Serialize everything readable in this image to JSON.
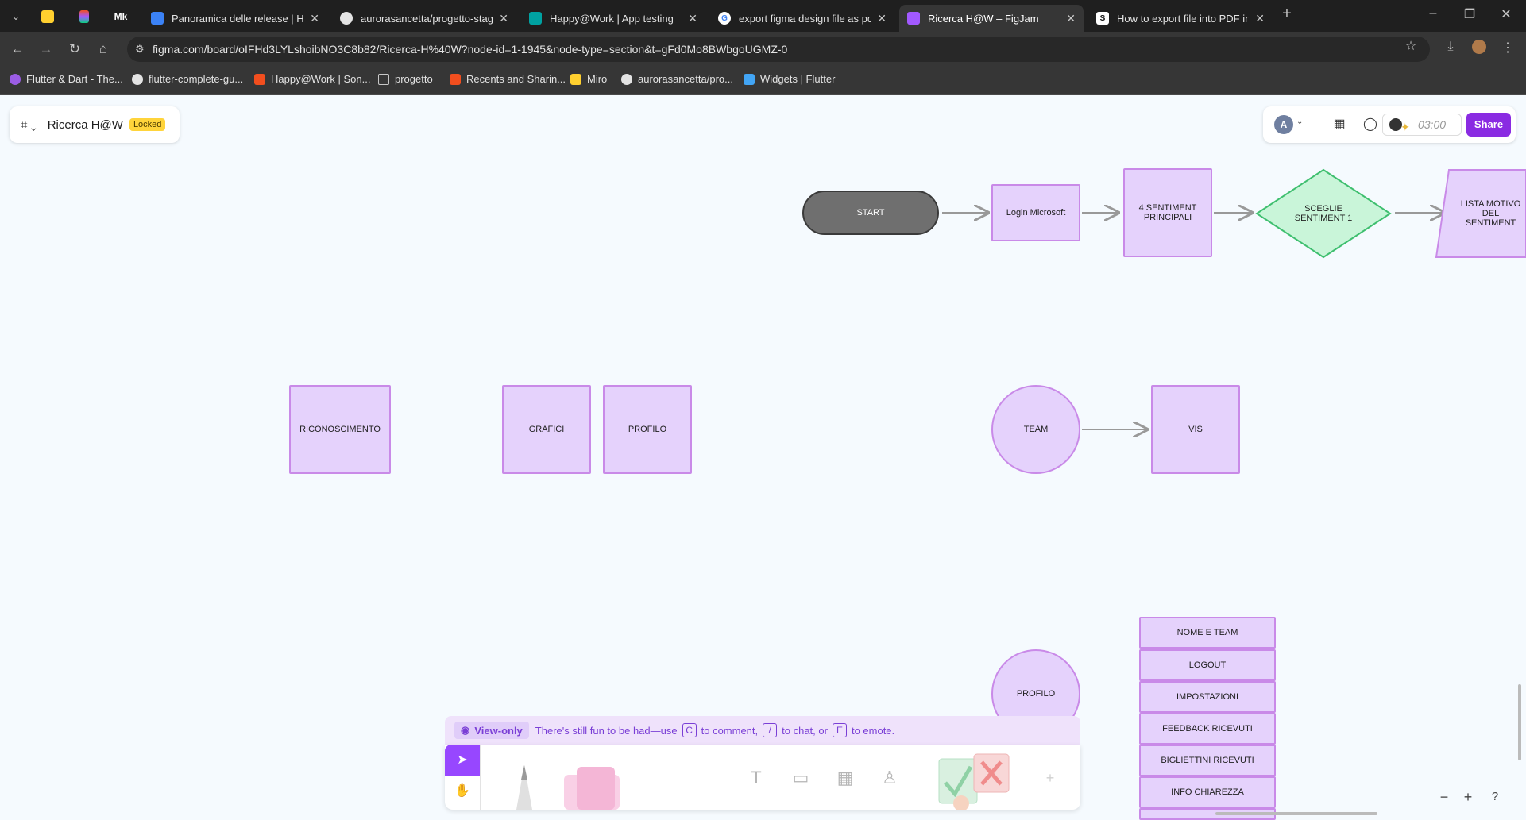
{
  "browser": {
    "tabs": [
      {
        "title": "Panoramica delle release | Happ",
        "favicon_color": "#3b82f6"
      },
      {
        "title": "aurorasancetta/progetto-stage",
        "favicon_color": "#e3e3e3"
      },
      {
        "title": "Happy@Work | App testing",
        "favicon_color": "#00a2a2"
      },
      {
        "title": "export figma design file as pdf",
        "favicon_color": "#ffffff"
      },
      {
        "title": "Ricerca H@W – FigJam",
        "favicon_color": "#a259ff"
      },
      {
        "title": "How to export file into PDF in F",
        "favicon_color": "#ffffff"
      }
    ],
    "pinned_tab_mk": "Mk",
    "url": "figma.com/board/oIFHd3LYLshoibNO3C8b82/Ricerca-H%40W?node-id=1-1945&node-type=section&t=gFd0Mo8BWbgoUGMZ-0",
    "bookmarks": [
      "Flutter & Dart - The...",
      "flutter-complete-gu...",
      "Happy@Work | Son...",
      "progetto",
      "Recents and Sharin...",
      "Miro",
      "aurorasancetta/pro...",
      "Widgets | Flutter"
    ]
  },
  "figjam": {
    "file_name": "Ricerca H@W",
    "locked_badge": "Locked",
    "avatar_initial": "A",
    "timer": "03:00",
    "share_label": "Share",
    "shapes": {
      "start": "START",
      "login": "Login Microsoft",
      "sentimenti": "4 SENTIMENT PRINCIPALI",
      "sceglie": "SCEGLIE SENTIMENT 1",
      "lista": "LISTA MOTIVO DEL SENTIMENT",
      "riconoscimento": "RICONOSCIMENTO",
      "grafici": "GRAFICI",
      "profilo_box": "PROFILO",
      "team": "TEAM",
      "vis": "VIS",
      "profilo_circle": "PROFILO"
    },
    "profile_menu": [
      "NOME E TEAM",
      "LOGOUT",
      "IMPOSTAZIONI",
      "FEEDBACK RICEVUTI",
      "BIGLIETTINI RICEVUTI",
      "INFO CHIAREZZA"
    ],
    "view_only": {
      "chip": "View-only",
      "text_a": "There's still fun to be had—use",
      "key_c": "C",
      "text_b": "to comment,",
      "key_slash": "/",
      "text_c": "to chat, or",
      "key_e": "E",
      "text_d": "to emote."
    },
    "zoom": {
      "minus": "−",
      "plus": "+",
      "help": "?"
    }
  },
  "colors": {
    "canvas": "#f5fafe",
    "shape_fill": "#e5d2fc",
    "shape_stroke": "#c98ae8",
    "diamond_fill": "#c9f5d9",
    "diamond_stroke": "#3fbf6f",
    "share": "#8a2be2"
  }
}
